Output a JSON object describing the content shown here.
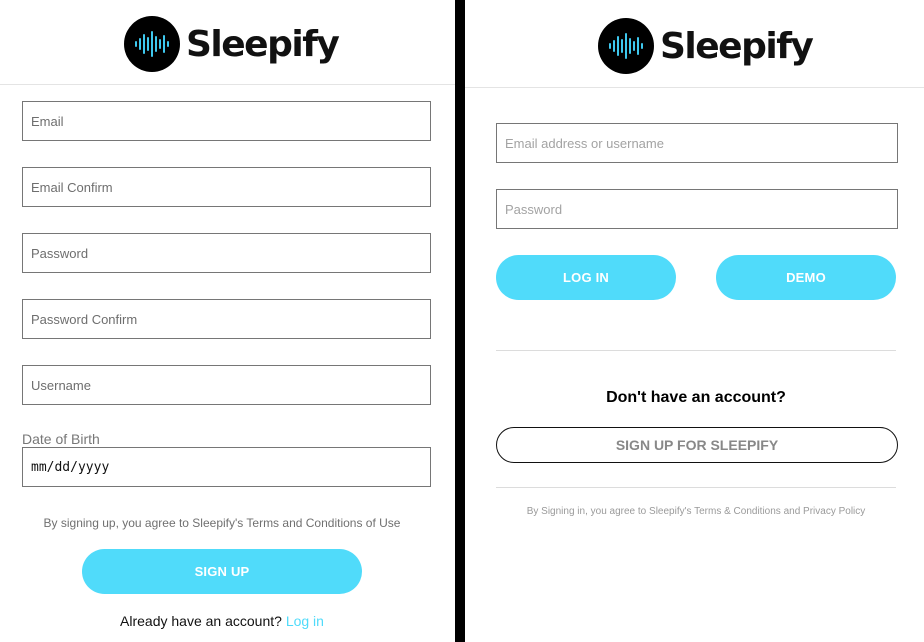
{
  "brand": {
    "name": "Sleepify",
    "accent_color": "#50dbfa",
    "logo_icon": "sound-wave-icon"
  },
  "signup": {
    "email_placeholder": "Email",
    "email_confirm_placeholder": "Email Confirm",
    "password_placeholder": "Password",
    "password_confirm_placeholder": "Password Confirm",
    "username_placeholder": "Username",
    "dob_label": "Date of Birth",
    "dob_value": "mm/dd/yyyy",
    "terms_text": "By signing up, you agree to Sleepify's Terms and Conditions of Use",
    "submit_label": "SIGN UP",
    "login_prompt": "Already have an account?",
    "login_link": "Log in"
  },
  "login": {
    "email_placeholder": "Email address or username",
    "password_placeholder": "Password",
    "login_label": "LOG IN",
    "demo_label": "DEMO",
    "no_account_heading": "Don't have an account?",
    "signup_label": "SIGN UP FOR SLEEPIFY",
    "terms_text": "By Signing in, you agree to Sleepify's Terms & Conditions and Privacy Policy"
  }
}
